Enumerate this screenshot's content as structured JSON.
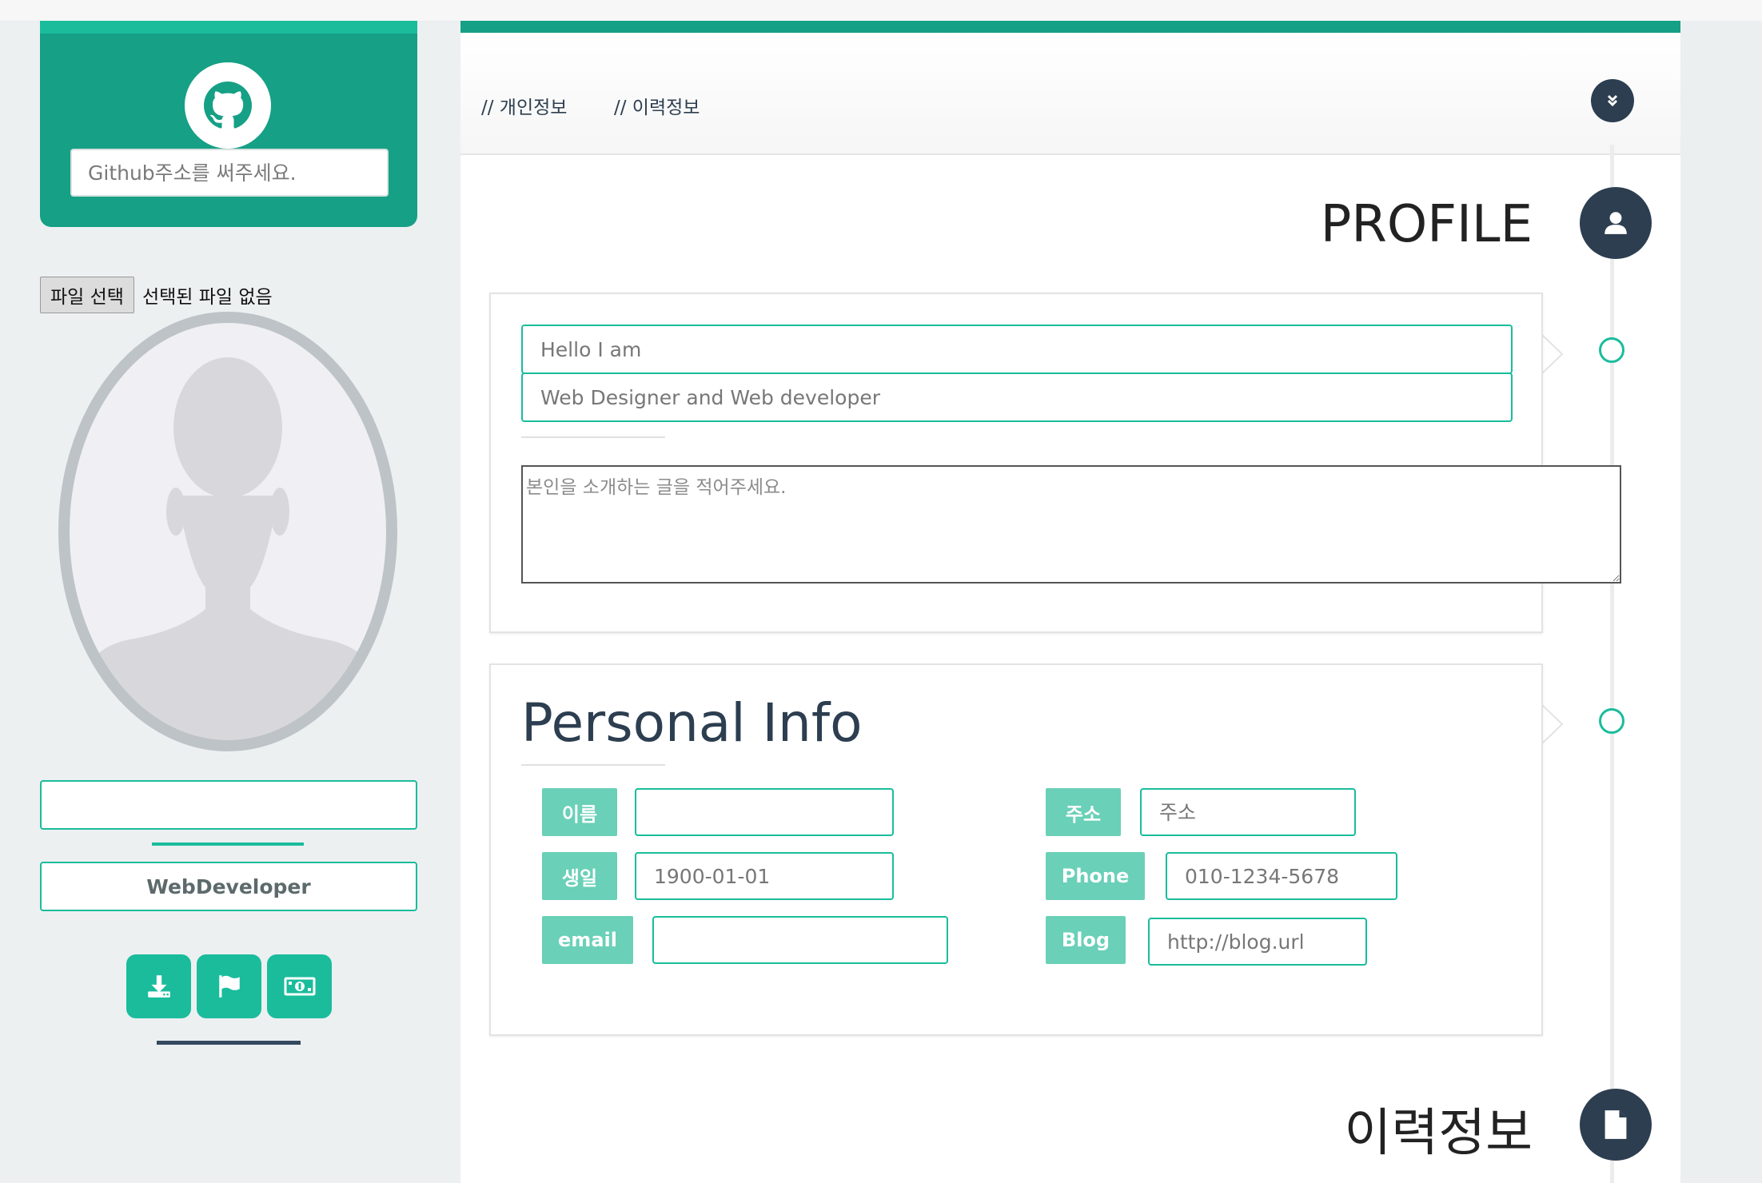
{
  "sidebar": {
    "github_placeholder": "Github주소를 써주세요.",
    "file_button_label": "파일 선택",
    "file_status": "선택된 파일 없음",
    "name_value": "",
    "job_title": "WebDeveloper",
    "action_buttons": [
      {
        "icon": "download-icon"
      },
      {
        "icon": "flag-icon"
      },
      {
        "icon": "money-icon"
      }
    ]
  },
  "nav": {
    "tabs": [
      {
        "label": "// 개인정보"
      },
      {
        "label": "// 이력정보"
      }
    ],
    "collapse_icon": "double-chevron-down-icon"
  },
  "sections": {
    "profile_title": "PROFILE",
    "career_title": "이력정보"
  },
  "intro": {
    "hello_placeholder": "Hello I am",
    "role_placeholder": "Web Designer and Web developer",
    "about_placeholder": "본인을 소개하는 글을 적어주세요."
  },
  "personal": {
    "title": "Personal Info",
    "fields": {
      "name": {
        "label": "이름",
        "value": "",
        "placeholder": ""
      },
      "birth": {
        "label": "생일",
        "value": "",
        "placeholder": "1900-01-01"
      },
      "email": {
        "label": "email",
        "value": "",
        "placeholder": ""
      },
      "address": {
        "label": "주소",
        "value": "",
        "placeholder": "주소"
      },
      "phone": {
        "label": "Phone",
        "value": "",
        "placeholder": "010-1234-5678"
      },
      "blog": {
        "label": "Blog",
        "value": "",
        "placeholder": "http://blog.url"
      }
    }
  },
  "colors": {
    "teal": "#1abc9c",
    "dark_teal": "#16a085",
    "navy": "#2c3e50",
    "label_green": "#6ad0b8",
    "background": "#ecf0f1"
  }
}
